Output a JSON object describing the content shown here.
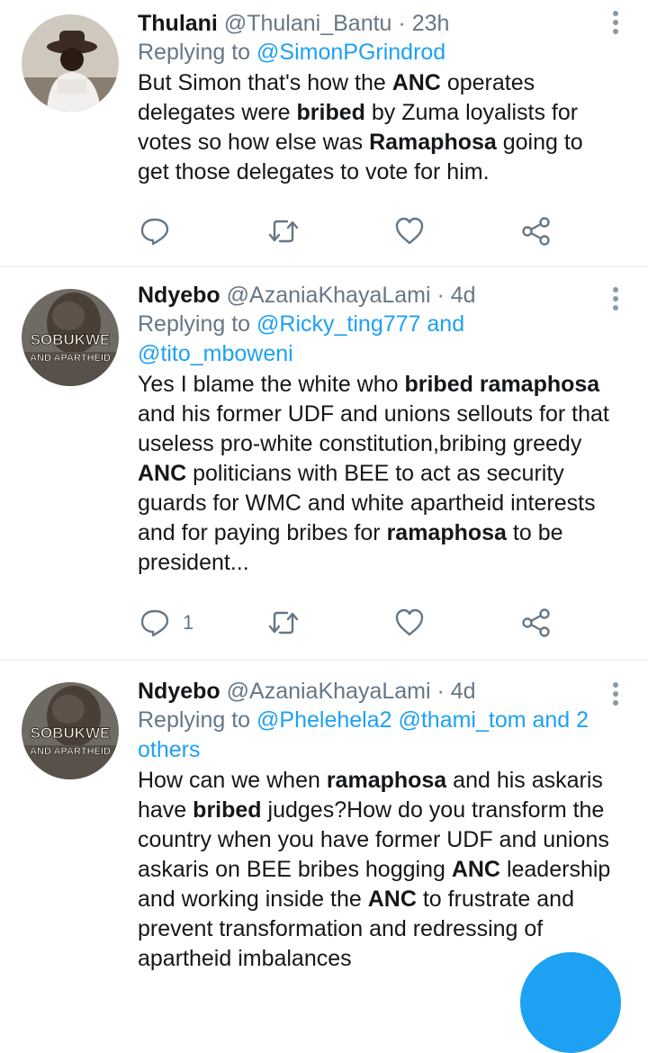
{
  "tweets": [
    {
      "name": "Thulani",
      "handle": "@Thulani_Bantu",
      "time": "23h",
      "reply_prefix": "Replying to ",
      "reply_to": "@SimonPGrindrod",
      "reply_to_2": "",
      "body": [
        {
          "t": "But Simon that's how the ",
          "b": false
        },
        {
          "t": "ANC",
          "b": true
        },
        {
          "t": " operates delegates were ",
          "b": false
        },
        {
          "t": "bribed",
          "b": true
        },
        {
          "t": " by Zuma loyalists for votes so how else was ",
          "b": false
        },
        {
          "t": "Ramaphosa",
          "b": true
        },
        {
          "t": " going to get those delegates to vote for him.",
          "b": false
        }
      ],
      "reply_count": ""
    },
    {
      "name": "Ndyebo",
      "handle": "@AzaniaKhayaLami",
      "time": "4d",
      "reply_prefix": "Replying to ",
      "reply_to": "@Ricky_ting777 and",
      "reply_to_2": "@tito_mboweni",
      "body": [
        {
          "t": "Yes I blame the white who ",
          "b": false
        },
        {
          "t": "bribed ramaphosa",
          "b": true
        },
        {
          "t": " and his former UDF and unions sellouts for that useless pro-white constitution,bribing greedy ",
          "b": false
        },
        {
          "t": "ANC",
          "b": true
        },
        {
          "t": " politicians with BEE to act as security guards for WMC and white apartheid interests and for paying bribes for ",
          "b": false
        },
        {
          "t": "ramaphosa",
          "b": true
        },
        {
          "t": " to be president...",
          "b": false
        }
      ],
      "reply_count": "1"
    },
    {
      "name": "Ndyebo",
      "handle": "@AzaniaKhayaLami",
      "time": "4d",
      "reply_prefix": "Replying to ",
      "reply_to": "@Phelehela2 @thami_tom and 2",
      "reply_to_2": "others",
      "body": [
        {
          "t": "How can we when ",
          "b": false
        },
        {
          "t": "ramaphosa",
          "b": true
        },
        {
          "t": " and his askaris have ",
          "b": false
        },
        {
          "t": "bribed",
          "b": true
        },
        {
          "t": " judges?How do you transform the country when you have former UDF and unions askaris on BEE bribes hogging ",
          "b": false
        },
        {
          "t": "ANC",
          "b": true
        },
        {
          "t": " leadership and working inside the ",
          "b": false
        },
        {
          "t": "ANC",
          "b": true
        },
        {
          "t": " to frustrate and prevent transformation and redressing of apartheid imbalances",
          "b": false
        }
      ],
      "reply_count": ""
    }
  ],
  "avatar_text": {
    "line1": "SOBUKWE",
    "line2": "AND APARTHEID"
  },
  "icons": [
    "reply-icon",
    "retweet-icon",
    "like-icon",
    "share-icon",
    "more-icon"
  ],
  "colors": {
    "accent": "#1da1f2",
    "muted": "#657786",
    "text": "#14171a",
    "divider": "#e1e8ed"
  }
}
